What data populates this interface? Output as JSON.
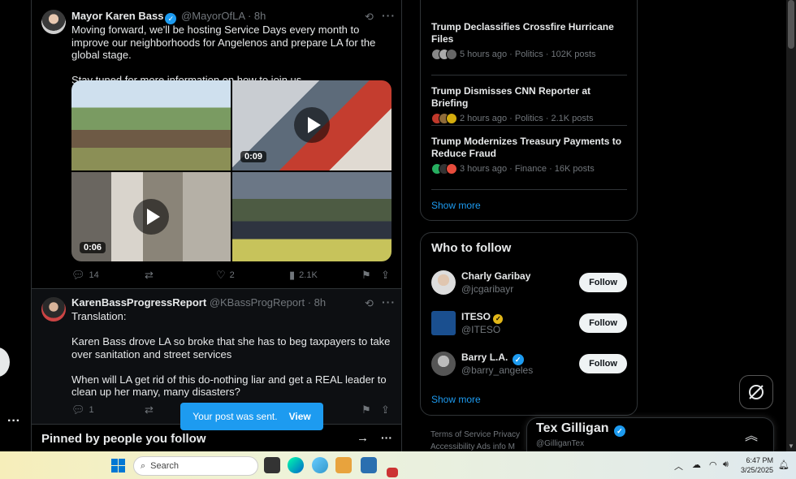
{
  "feed": {
    "tweet1": {
      "name": "Mayor Karen Bass",
      "handle": "@MayorOfLA",
      "time": "· 8h",
      "text": "Moving forward, we'll be hosting Service Days every month to improve our neighborhoods for Angelenos and prepare LA for the global stage.\n\nStay tuned for more information on how to join us.",
      "video1_duration": "0:09",
      "video2_duration": "0:06",
      "replies": "14",
      "reposts": "",
      "likes": "2",
      "views": "2.1K"
    },
    "tweet2": {
      "name": "KarenBassProgressReport",
      "handle": "@KBassProgReport",
      "time": "· 8h",
      "text": "Translation:\n\nKaren Bass drove LA so broke that she has to beg taxpayers to take over sanitation and street services\n\nWhen will LA get rid of this do-nothing liar and get a REAL leader to clean up her many, many disasters?",
      "replies": "1"
    },
    "pinned_title": "Pinned by people you follow",
    "toast": {
      "text": "Your post was sent.",
      "action": "View"
    }
  },
  "trends": {
    "items": [
      {
        "title": "Trump Declassifies Crossfire Hurricane Files",
        "meta": "5 hours ago · Politics · 102K posts"
      },
      {
        "title": "Trump Dismisses CNN Reporter at Briefing",
        "meta": "2 hours ago · Politics · 2.1K posts"
      },
      {
        "title": "Trump Modernizes Treasury Payments to Reduce Fraud",
        "meta": "3 hours ago · Finance · 16K posts"
      }
    ],
    "show_more": "Show more"
  },
  "who_to_follow": {
    "title": "Who to follow",
    "users": [
      {
        "name": "Charly Garibay",
        "handle": "@jcgaribayr",
        "button": "Follow"
      },
      {
        "name": "ITESO",
        "handle": "@ITESO",
        "button": "Follow"
      },
      {
        "name": "Barry L.A.",
        "handle": "@barry_angeles",
        "button": "Follow"
      }
    ],
    "show_more": "Show more"
  },
  "footer": {
    "line1": "Terms of Service  Privacy",
    "line2": "Accessibility  Ads info  M"
  },
  "messages": {
    "name": "Tex Gilligan",
    "handle": "@GilliganTex"
  },
  "taskbar": {
    "search_placeholder": "Search",
    "time": "6:47 PM",
    "date": "3/25/2025"
  },
  "colors": {
    "accent": "#1d9bf0",
    "background": "#000000"
  }
}
